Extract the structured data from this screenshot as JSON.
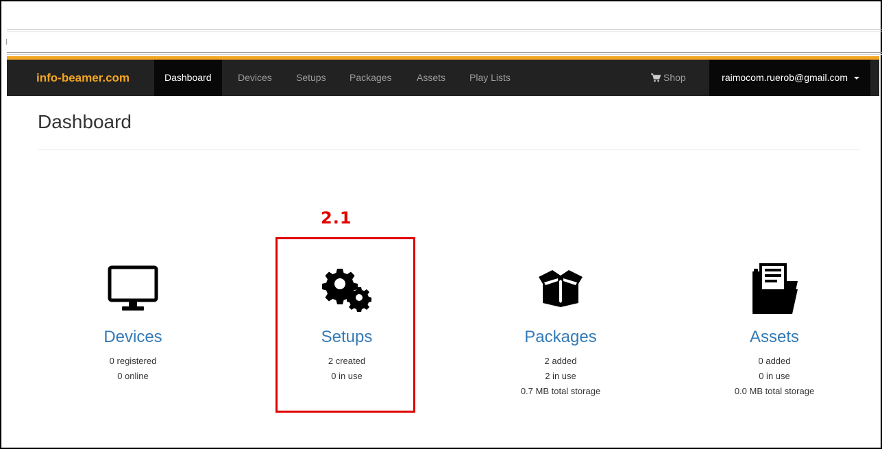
{
  "navbar": {
    "brand": "info-beamer.com",
    "items": [
      "Dashboard",
      "Devices",
      "Setups",
      "Packages",
      "Assets",
      "Play Lists"
    ],
    "active": "Dashboard",
    "shop_label": "Shop",
    "user_email": "raimocom.ruerob@gmail.com",
    "brand_color": "#f3a623"
  },
  "page": {
    "title": "Dashboard"
  },
  "annotation": {
    "label": "2.1",
    "color": "#e00000"
  },
  "tiles": [
    {
      "title": "Devices",
      "icon": "monitor-icon",
      "stats": [
        "0 registered",
        "0 online"
      ]
    },
    {
      "title": "Setups",
      "icon": "gears-icon",
      "stats": [
        "2 created",
        "0 in use"
      ]
    },
    {
      "title": "Packages",
      "icon": "open-box-icon",
      "stats": [
        "2 added",
        "2 in use",
        "0.7 MB total storage"
      ]
    },
    {
      "title": "Assets",
      "icon": "folder-documents-icon",
      "stats": [
        "0 added",
        "0 in use",
        "0.0 MB total storage"
      ]
    }
  ]
}
